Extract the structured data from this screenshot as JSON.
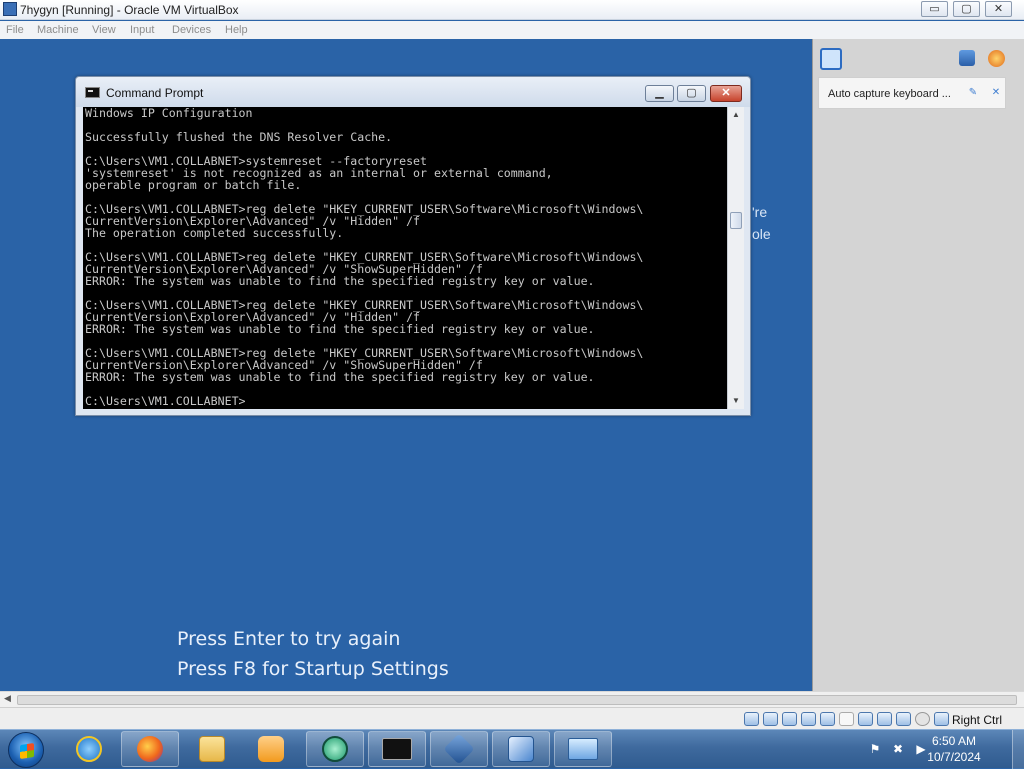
{
  "host_window": {
    "title": "7hygyn [Running] - Oracle VM VirtualBox",
    "minimize": "▭",
    "maximize": "▢",
    "close": "✕"
  },
  "menubar": [
    "File",
    "Machine",
    "View",
    "Input",
    "Devices",
    "Help"
  ],
  "cmd_window": {
    "title": "Command Prompt",
    "lines": [
      "Windows IP Configuration",
      "",
      "Successfully flushed the DNS Resolver Cache.",
      "",
      "C:\\Users\\VM1.COLLABNET>systemreset --factoryreset",
      "'systemreset' is not recognized as an internal or external command,",
      "operable program or batch file.",
      "",
      "C:\\Users\\VM1.COLLABNET>reg delete \"HKEY_CURRENT_USER\\Software\\Microsoft\\Windows\\",
      "CurrentVersion\\Explorer\\Advanced\" /v \"Hidden\" /f",
      "The operation completed successfully.",
      "",
      "C:\\Users\\VM1.COLLABNET>reg delete \"HKEY_CURRENT_USER\\Software\\Microsoft\\Windows\\",
      "CurrentVersion\\Explorer\\Advanced\" /v \"ShowSuperHidden\" /f",
      "ERROR: The system was unable to find the specified registry key or value.",
      "",
      "C:\\Users\\VM1.COLLABNET>reg delete \"HKEY_CURRENT_USER\\Software\\Microsoft\\Windows\\",
      "CurrentVersion\\Explorer\\Advanced\" /v \"Hidden\" /f",
      "ERROR: The system was unable to find the specified registry key or value.",
      "",
      "C:\\Users\\VM1.COLLABNET>reg delete \"HKEY_CURRENT_USER\\Software\\Microsoft\\Windows\\",
      "CurrentVersion\\Explorer\\Advanced\" /v \"ShowSuperHidden\" /f",
      "ERROR: The system was unable to find the specified registry key or value.",
      "",
      "C:\\Users\\VM1.COLLABNET>"
    ]
  },
  "guest_screen": {
    "partial_text_1": "'re",
    "partial_text_2": "ole",
    "press_enter": "Press Enter to try again",
    "press_f8": "Press F8 for Startup Settings"
  },
  "side_panel": {
    "notification": "Auto capture keyboard ..."
  },
  "status_bar": {
    "host_key": "Right Ctrl"
  },
  "taskbar": {
    "apps": [
      "internet-explorer",
      "firefox",
      "file-explorer",
      "media-player",
      "app-circle",
      "command-prompt",
      "virtualbox",
      "windows-7-usb-tool",
      "control-panel"
    ],
    "clock_time": "6:50 AM",
    "clock_date": "10/7/2024"
  },
  "colors": {
    "guest_background": "#2a63a7",
    "console_background": "#000000",
    "console_text": "#c8c8c8",
    "taskbar": "#3f6a9e"
  }
}
